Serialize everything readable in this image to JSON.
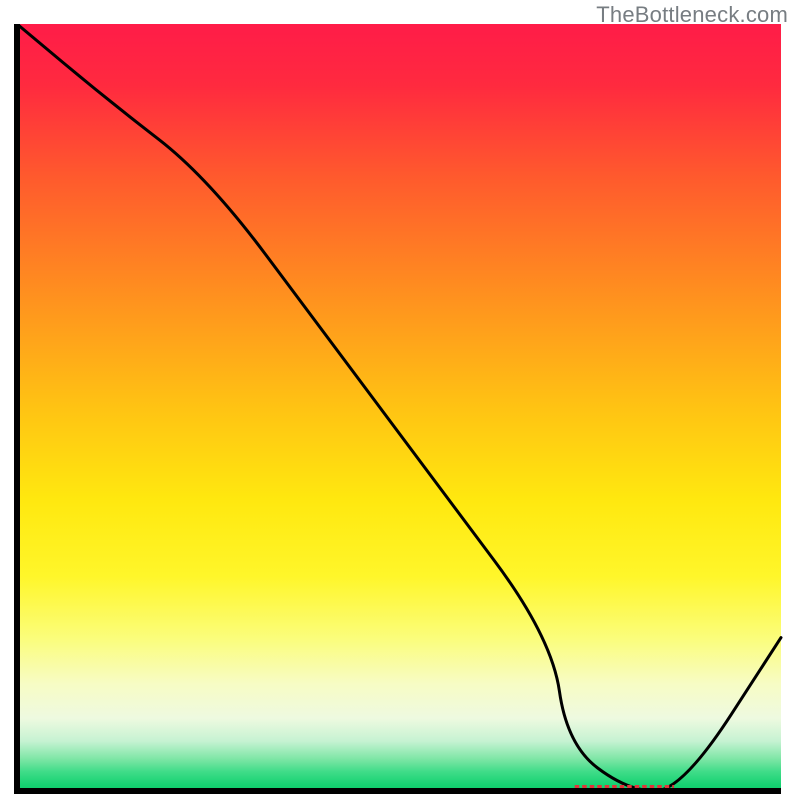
{
  "attribution": "TheBottleneck.com",
  "chart_data": {
    "type": "line",
    "title": "",
    "xlabel": "",
    "ylabel": "",
    "xlim": [
      0,
      100
    ],
    "ylim": [
      0,
      100
    ],
    "series": [
      {
        "name": "curve",
        "x": [
          0,
          12,
          25,
          40,
          55,
          70,
          72,
          80,
          87,
          100
        ],
        "y": [
          100,
          90,
          80,
          60,
          40,
          20,
          6,
          0,
          0,
          20
        ]
      }
    ],
    "marker": {
      "x_start": 73,
      "x_end": 86,
      "y": 0
    },
    "gradient_stops": [
      {
        "offset": 0.0,
        "color": "#ff1c48"
      },
      {
        "offset": 0.08,
        "color": "#ff2a3f"
      },
      {
        "offset": 0.2,
        "color": "#ff5a2d"
      },
      {
        "offset": 0.35,
        "color": "#ff8f1f"
      },
      {
        "offset": 0.5,
        "color": "#ffc313"
      },
      {
        "offset": 0.62,
        "color": "#ffe80f"
      },
      {
        "offset": 0.72,
        "color": "#fff62a"
      },
      {
        "offset": 0.8,
        "color": "#fbfd7a"
      },
      {
        "offset": 0.86,
        "color": "#f7fcc4"
      },
      {
        "offset": 0.905,
        "color": "#eefae0"
      },
      {
        "offset": 0.935,
        "color": "#c6f2d2"
      },
      {
        "offset": 0.958,
        "color": "#7fe6a6"
      },
      {
        "offset": 0.975,
        "color": "#3fdc88"
      },
      {
        "offset": 0.992,
        "color": "#16d272"
      },
      {
        "offset": 1.0,
        "color": "#0fce6c"
      }
    ]
  }
}
